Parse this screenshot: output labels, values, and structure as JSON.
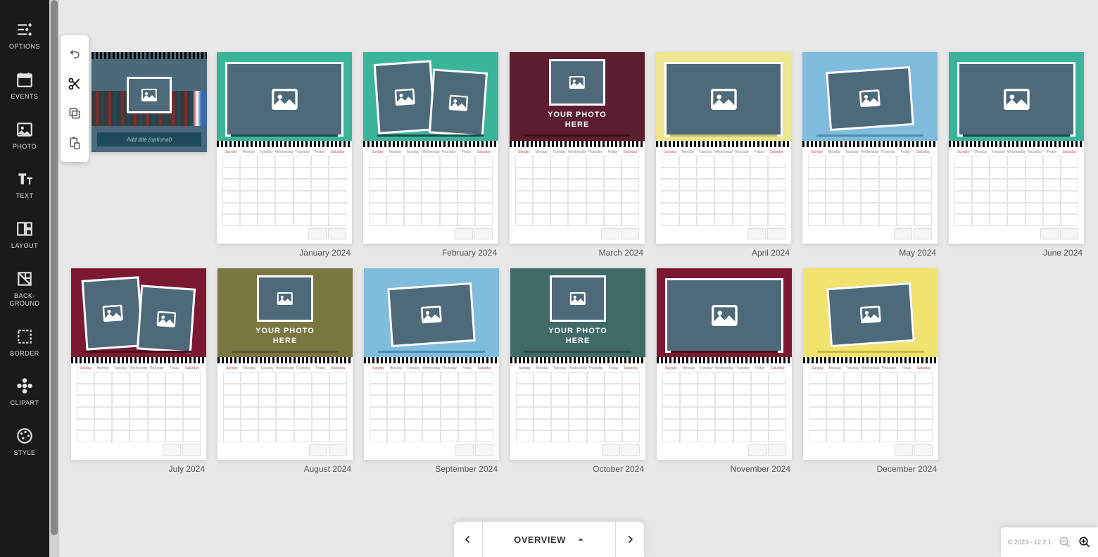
{
  "sidebar": {
    "items": [
      {
        "label": "OPTIONS",
        "icon": "options"
      },
      {
        "label": "EVENTS",
        "icon": "events"
      },
      {
        "label": "PHOTO",
        "icon": "photo"
      },
      {
        "label": "TEXT",
        "icon": "text"
      },
      {
        "label": "LAYOUT",
        "icon": "layout"
      },
      {
        "label": "BACK-\nGROUND",
        "icon": "background"
      },
      {
        "label": "BORDER",
        "icon": "border"
      },
      {
        "label": "CLIPART",
        "icon": "clipart"
      },
      {
        "label": "STYLE",
        "icon": "style"
      }
    ]
  },
  "floating_tools": {
    "items": [
      {
        "name": "undo",
        "enabled": true
      },
      {
        "name": "cut",
        "enabled": false
      },
      {
        "name": "copy",
        "enabled": true
      },
      {
        "name": "paste",
        "enabled": true
      }
    ]
  },
  "cover": {
    "title_placeholder": "Add title (optional)"
  },
  "placeholder_text": "YOUR PHOTO\nHERE",
  "day_names": [
    "Sunday",
    "Monday",
    "Tuesday",
    "Wednesday",
    "Thursday",
    "Friday",
    "Saturday"
  ],
  "colors": {
    "teal": "#3cb49b",
    "maroon": "#5c1e2e",
    "olive": "#7a7640",
    "skyblue": "#7fbcde",
    "slate": "#3f6a66",
    "yellow": "#ede793",
    "yellow2": "#f2e36e",
    "darkred": "#7d1832",
    "frame_fill": "#4e6a7a"
  },
  "months": [
    {
      "label": "January 2024",
      "bg": "teal",
      "layout": "single",
      "show_text": false,
      "accent": "#1e4a4a"
    },
    {
      "label": "February 2024",
      "bg": "teal",
      "layout": "double_tilt",
      "show_text": false,
      "accent": "#1e4a4a"
    },
    {
      "label": "March 2024",
      "bg": "maroon",
      "layout": "single_text",
      "show_text": true,
      "accent": "#3a0f1a"
    },
    {
      "label": "April 2024",
      "bg": "yellow",
      "layout": "single",
      "show_text": false,
      "accent": "#c5c060"
    },
    {
      "label": "May 2024",
      "bg": "skyblue",
      "layout": "single_tilt",
      "show_text": false,
      "accent": "#4a8db3"
    },
    {
      "label": "June 2024",
      "bg": "teal",
      "layout": "single",
      "show_text": false,
      "accent": "#1e4a4a"
    },
    {
      "label": "July 2024",
      "bg": "darkred",
      "layout": "double_tilt",
      "show_text": false,
      "accent": "#4a0f1e"
    },
    {
      "label": "August 2024",
      "bg": "olive",
      "layout": "single_text",
      "show_text": true,
      "accent": "#5a5628"
    },
    {
      "label": "September 2024",
      "bg": "skyblue",
      "layout": "single_tilt",
      "show_text": false,
      "accent": "#4a8db3"
    },
    {
      "label": "October 2024",
      "bg": "slate",
      "layout": "single_text",
      "show_text": true,
      "accent": "#2a4a46"
    },
    {
      "label": "November 2024",
      "bg": "darkred",
      "layout": "single",
      "show_text": false,
      "accent": "#4a0f1e"
    },
    {
      "label": "December 2024",
      "bg": "yellow2",
      "layout": "single_tilt",
      "show_text": false,
      "accent": "#c5b940"
    }
  ],
  "bottom": {
    "overview_label": "OVERVIEW"
  },
  "footer": {
    "version": "© 2023 - 12.2.1"
  }
}
